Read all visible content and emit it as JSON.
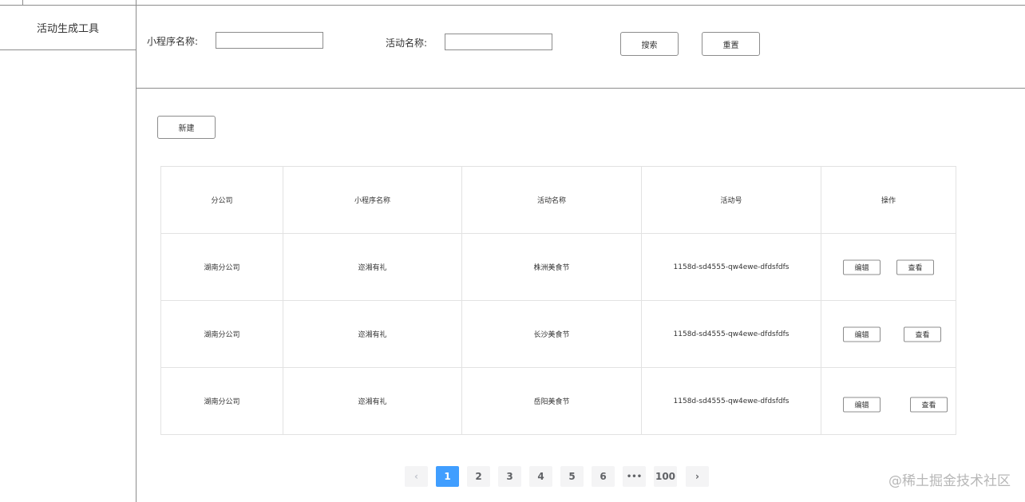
{
  "sidebar": {
    "items": [
      {
        "label": "活动生成工具"
      }
    ]
  },
  "search": {
    "mini_program_label": "小程序名称:",
    "mini_program_value": "",
    "activity_label": "活动名称:",
    "activity_value": "",
    "search_button": "搜索",
    "reset_button": "重置"
  },
  "toolbar": {
    "new_button": "新建"
  },
  "table": {
    "headers": [
      "分公司",
      "小程序名称",
      "活动名称",
      "活动号",
      "操作"
    ],
    "rows": [
      {
        "branch": "湖南分公司",
        "mini_program": "迩湘有礼",
        "activity": "株洲美食节",
        "activity_id": "1158d-sd4555-qw4ewe-dfdsfdfs",
        "edit": "编辑",
        "view": "查看"
      },
      {
        "branch": "湖南分公司",
        "mini_program": "迩湘有礼",
        "activity": "长沙美食节",
        "activity_id": "1158d-sd4555-qw4ewe-dfdsfdfs",
        "edit": "编辑",
        "view": "查看"
      },
      {
        "branch": "湖南分公司",
        "mini_program": "迩湘有礼",
        "activity": "岳阳美食节",
        "activity_id": "1158d-sd4555-qw4ewe-dfdsfdfs",
        "edit": "编辑",
        "view": "查看"
      }
    ]
  },
  "pagination": {
    "prev": "‹",
    "pages": [
      "1",
      "2",
      "3",
      "4",
      "5",
      "6",
      "•••",
      "100"
    ],
    "current": "1",
    "next": "›"
  },
  "watermark": "@稀土掘金技术社区",
  "colors": {
    "active_page": "#409eff",
    "border": "#8c8c8c"
  }
}
